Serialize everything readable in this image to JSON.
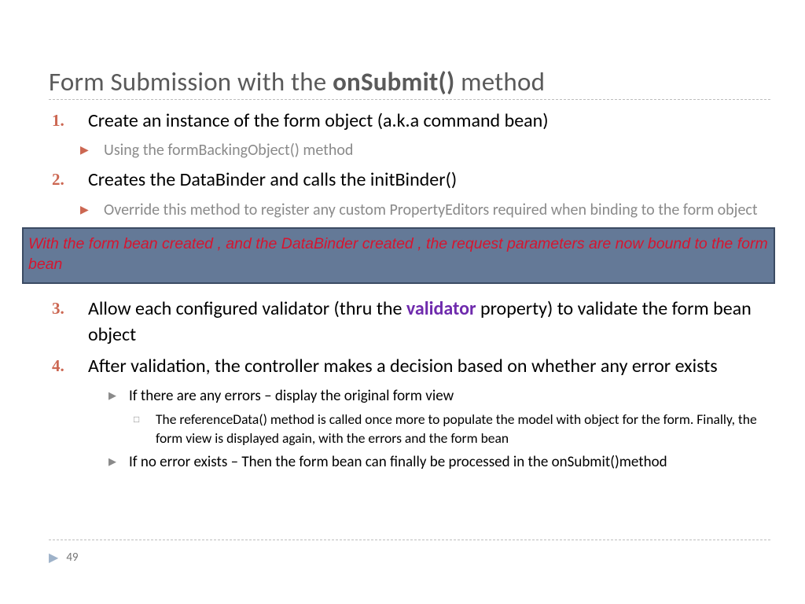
{
  "title": {
    "prefix": "Form Submission with the ",
    "bold": "onSubmit()",
    "suffix": " method"
  },
  "items": [
    {
      "num": "1.",
      "text": "Create an instance of the form object (a.k.a command bean)"
    },
    {
      "sub": "Using the formBackingObject() method"
    },
    {
      "num": "2.",
      "text": "Creates the DataBinder and calls the initBinder()"
    },
    {
      "sub": "Override this method to register any custom PropertyEditors required when binding to the form object"
    }
  ],
  "callout": "With the form bean created , and the DataBinder created , the request parameters are now bound to the form bean",
  "items2": {
    "item3": {
      "num": "3.",
      "pre": "Allow each configured validator (thru the ",
      "emph": "validator",
      "post": " property) to validate the form bean object"
    },
    "item4": {
      "num": "4.",
      "text": "After validation, the controller makes a decision based on whether any error exists"
    },
    "sub4a": "If there are any errors – display the original form view",
    "sub4a_detail": "The referenceData() method is called once more to populate the model with object for the form. Finally, the form view is displayed again, with the errors and the form bean",
    "sub4b": "If no error exists – Then the form bean can finally be processed in the onSubmit()method"
  },
  "pageNumber": "49"
}
